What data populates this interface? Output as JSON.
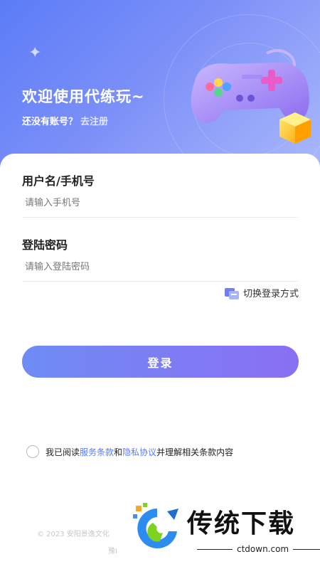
{
  "header": {
    "welcome_title": "欢迎使用代练玩~",
    "no_account_text": "还没有账号？",
    "register_link": "去注册"
  },
  "form": {
    "username_label": "用户名/手机号",
    "username_placeholder": "请输入手机号",
    "password_label": "登陆密码",
    "password_placeholder": "请输入登陆密码",
    "switch_login_label": "切换登录方式",
    "login_button": "登录"
  },
  "agreement": {
    "prefix": "我已阅读",
    "terms_link": "服务条款",
    "and": "和",
    "privacy_link": "隐私协议",
    "suffix": "并理解相关条款内容"
  },
  "footer": {
    "copyright": "© 2023 安阳景逸文化",
    "line2": "豫I"
  },
  "watermark": {
    "title": "传统下载",
    "url": "ctdown.com"
  },
  "colors": {
    "accent": "#5b7cf7",
    "button_start": "#6f8cf5",
    "button_end": "#8a6ff3"
  }
}
